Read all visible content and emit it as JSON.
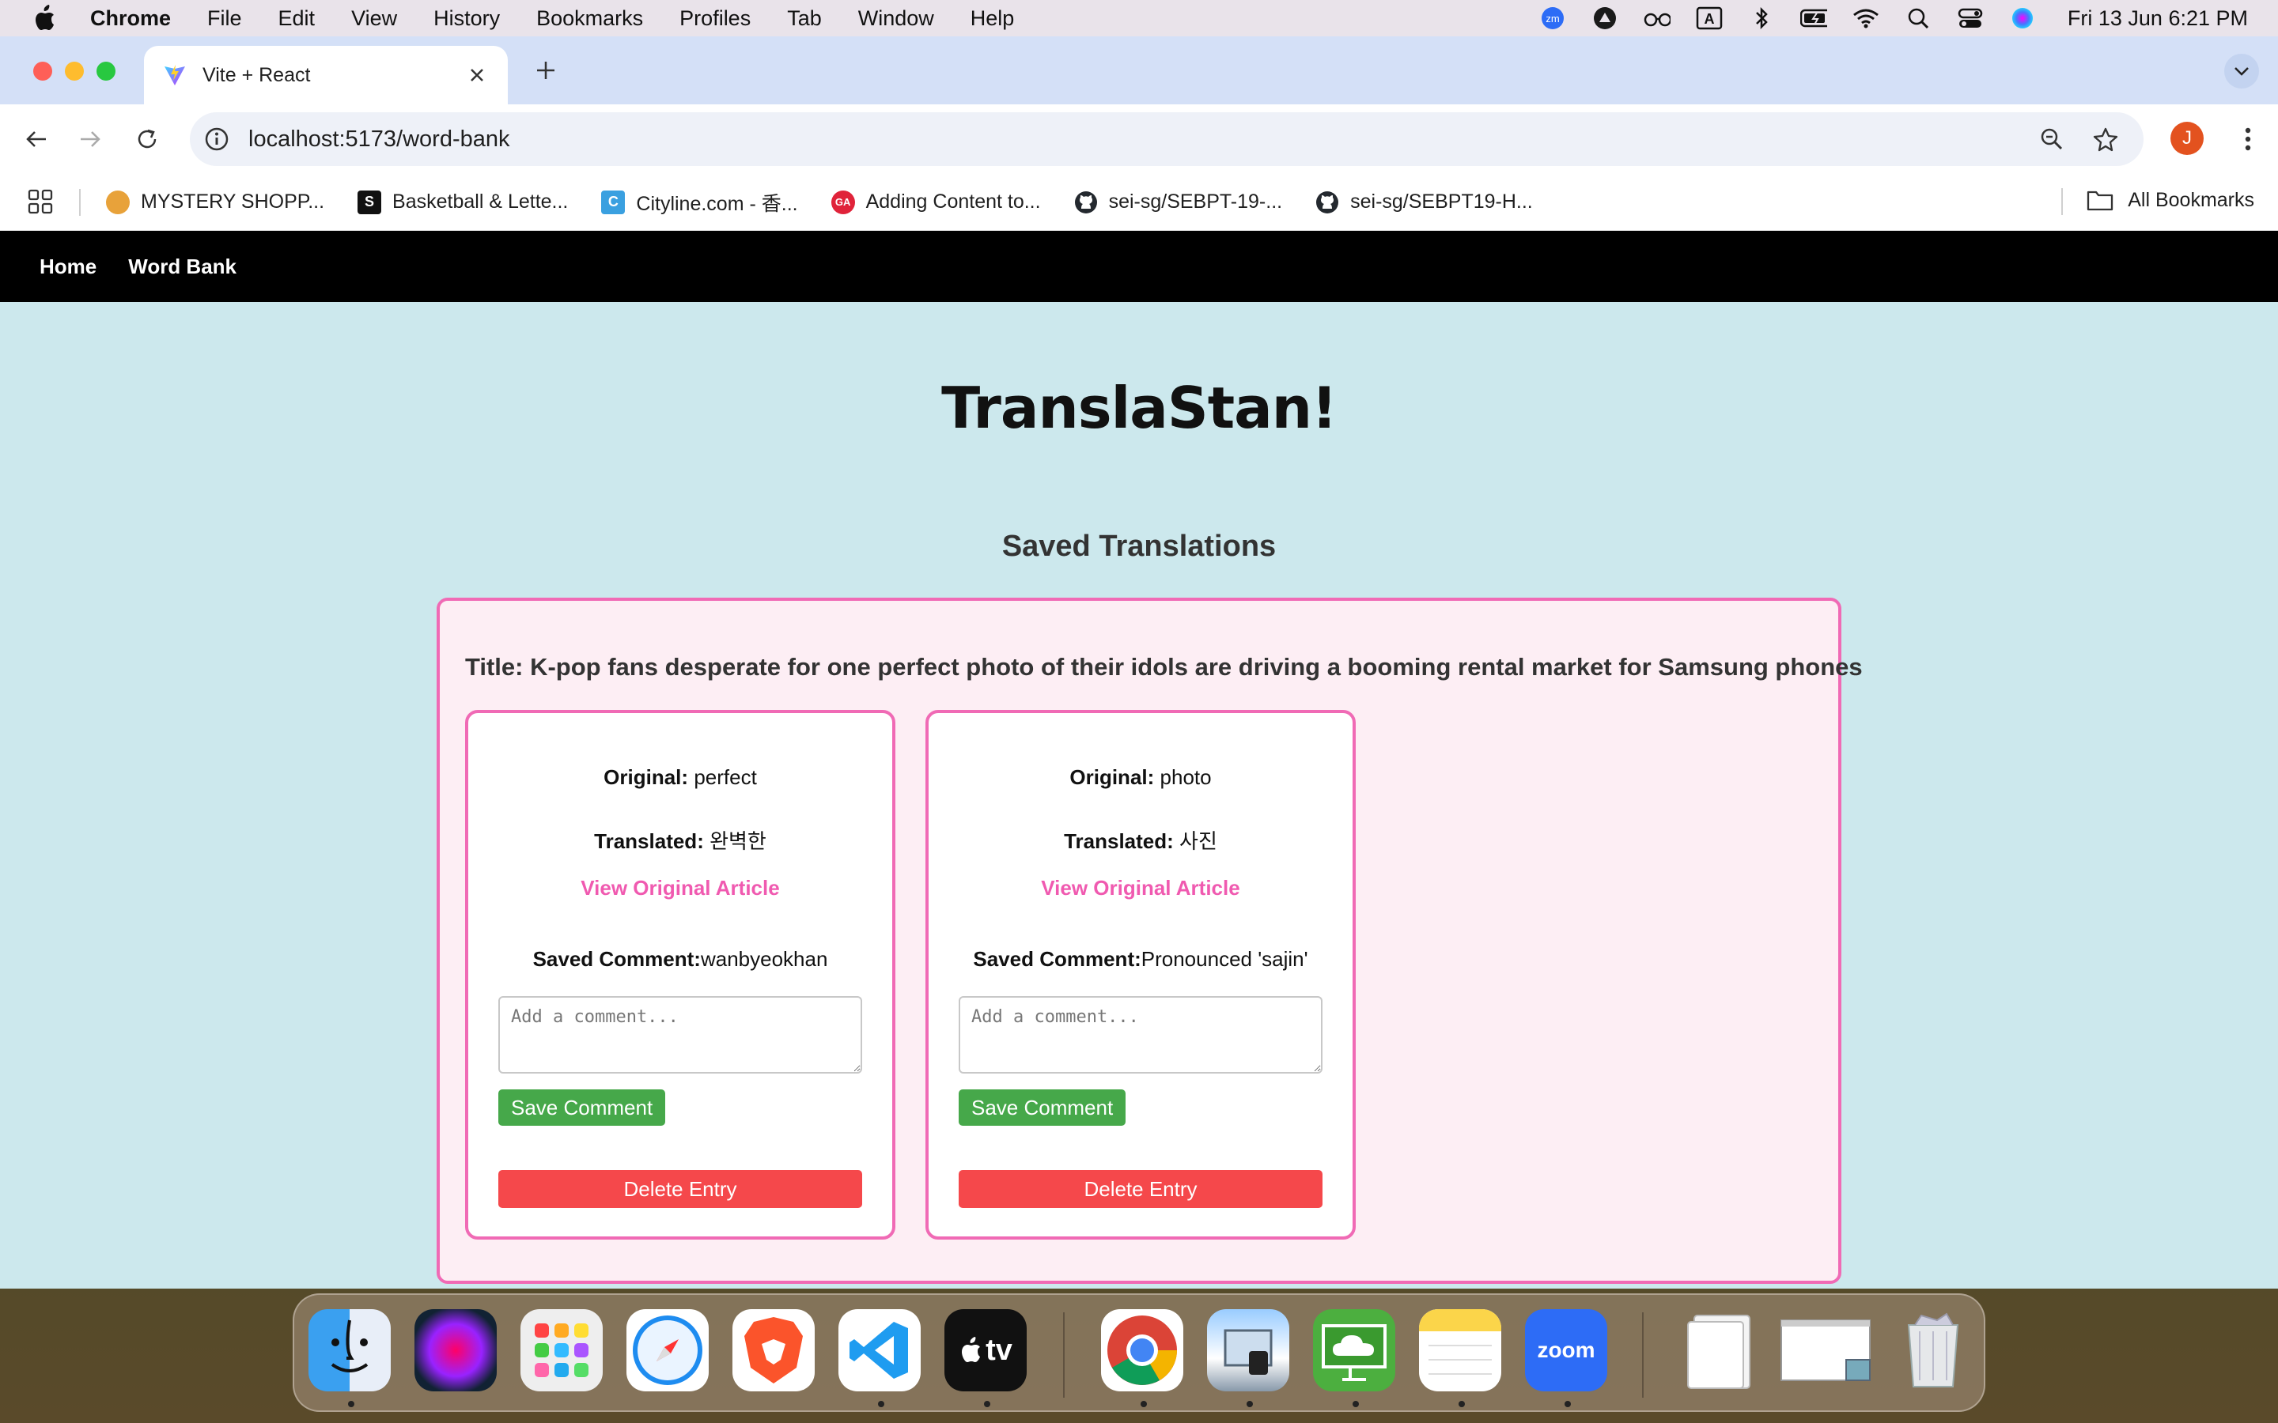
{
  "menubar": {
    "app_name": "Chrome",
    "items": [
      "File",
      "Edit",
      "View",
      "History",
      "Bookmarks",
      "Profiles",
      "Tab",
      "Window",
      "Help"
    ],
    "status_icons": [
      "zoom-status-icon",
      "scrobbler-icon",
      "reader-glasses-icon",
      "input-source-a-icon",
      "bluetooth-icon",
      "battery-icon",
      "wifi-icon",
      "spotlight-icon",
      "control-center-icon",
      "siri-icon"
    ],
    "input_source_label": "A",
    "zoom_badge": "zm",
    "clock": "Fri 13 Jun  6:21 PM"
  },
  "browser": {
    "tab_title": "Vite + React",
    "url": "localhost:5173/word-bank",
    "profile_initial": "J",
    "bookmarks": [
      {
        "label": "MYSTERY SHOPP...",
        "icon": "mystery-shopper-icon",
        "color": "#e8a23a",
        "glyph": ""
      },
      {
        "label": "Basketball & Lette...",
        "icon": "s-square-icon",
        "color": "#111111",
        "glyph": "S"
      },
      {
        "label": "Cityline.com - 香...",
        "icon": "cityline-icon",
        "color": "#3aa0e0",
        "glyph": "C"
      },
      {
        "label": "Adding Content to...",
        "icon": "ga-icon",
        "color": "#e0233a",
        "glyph": "GA"
      },
      {
        "label": "sei-sg/SEBPT-19-...",
        "icon": "github-icon",
        "color": "#24292f",
        "glyph": ""
      },
      {
        "label": "sei-sg/SEBPT19-H...",
        "icon": "github-icon",
        "color": "#24292f",
        "glyph": ""
      }
    ],
    "all_bookmarks": "All Bookmarks"
  },
  "site": {
    "nav": [
      "Home",
      "Word Bank"
    ],
    "brand": "TranslaStan!",
    "section_title": "Saved Translations",
    "article": {
      "title": "Title: K-pop fans desperate for one perfect photo of their idols are driving a booming rental market for Samsung phones",
      "cards": [
        {
          "original_label": "Original:",
          "original": "perfect",
          "translated_label": "Translated:",
          "translated": "완벽한",
          "link": "View Original Article",
          "comment_label": "Saved Comment:",
          "comment": "wanbyeokhan",
          "placeholder": "Add a comment...",
          "save_label": "Save Comment",
          "delete_label": "Delete Entry"
        },
        {
          "original_label": "Original:",
          "original": "photo",
          "translated_label": "Translated:",
          "translated": "사진",
          "link": "View Original Article",
          "comment_label": "Saved Comment:",
          "comment": "Pronounced 'sajin'",
          "placeholder": "Add a comment...",
          "save_label": "Save Comment",
          "delete_label": "Delete Entry"
        }
      ]
    }
  },
  "dock": {
    "apps": [
      "finder-icon",
      "siri-icon",
      "launchpad-icon",
      "safari-icon",
      "brave-icon",
      "vscode-icon",
      "apple-tv-icon",
      "chrome-icon",
      "preview-icon",
      "cloud-screen-icon",
      "notes-icon",
      "zoom-icon",
      "documents-folder-icon",
      "screenshot-stack-icon",
      "trash-icon"
    ],
    "zoom_label": "zoom",
    "tv_label": "tv"
  }
}
